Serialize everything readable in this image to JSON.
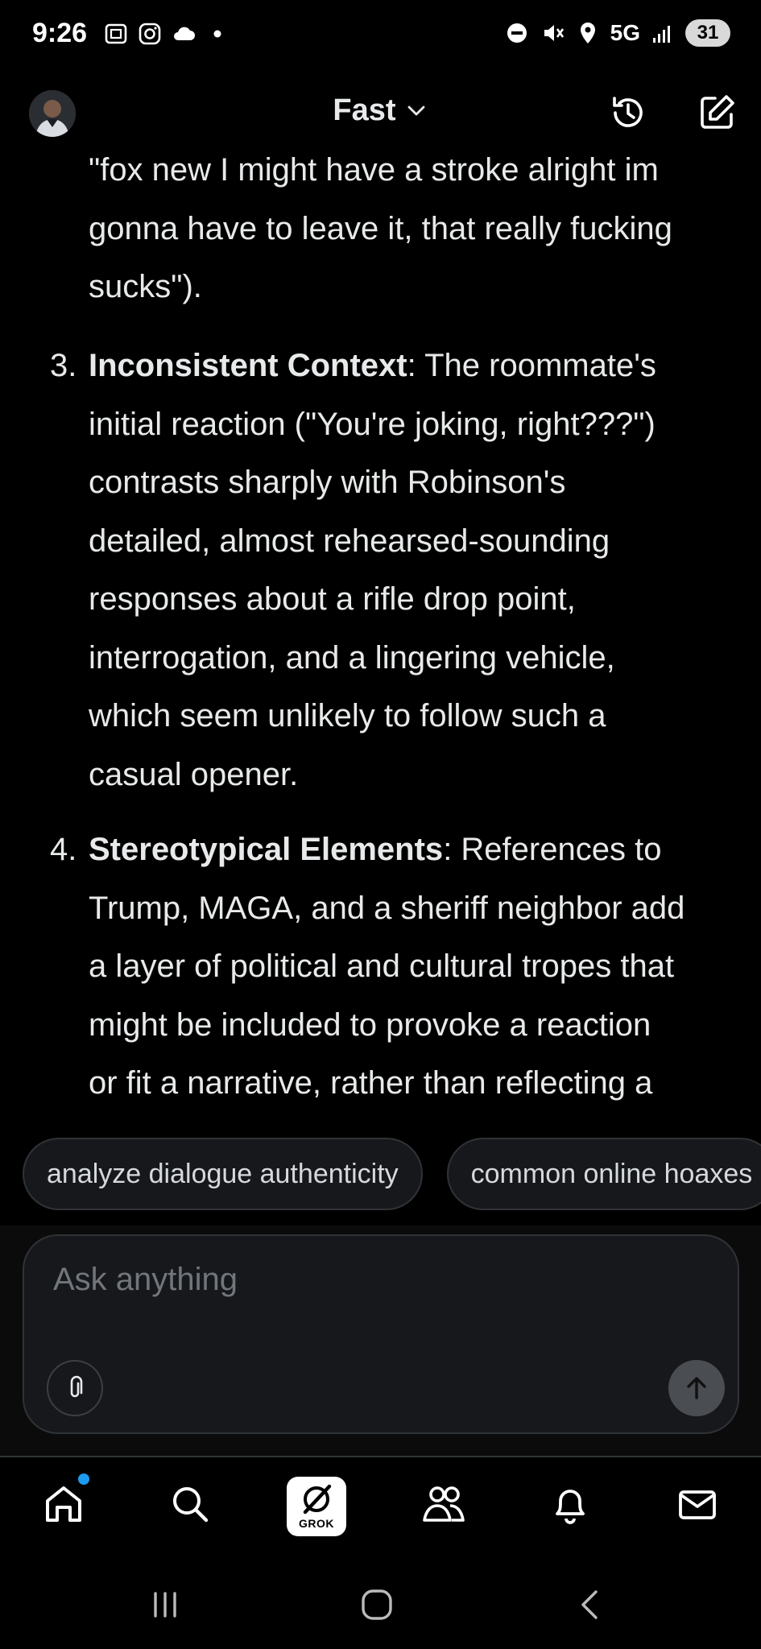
{
  "status_bar": {
    "time": "9:26",
    "network": "5G",
    "battery": "31"
  },
  "header": {
    "model_label": "Fast"
  },
  "message": {
    "lead_lines": [
      "\"fox new I might have a stroke alright im",
      "gonna have to leave it, that really fucking",
      "sucks\")."
    ],
    "items": [
      {
        "number": "3.",
        "title": "Inconsistent Context",
        "lines": [
          ": The roommate's",
          "initial reaction (\"You're joking, right???\")",
          "contrasts sharply with Robinson's",
          "detailed, almost rehearsed-sounding",
          "responses about a rifle drop point,",
          "interrogation, and a lingering vehicle,",
          "which seem unlikely to follow such a",
          "casual opener."
        ]
      },
      {
        "number": "4.",
        "title": "Stereotypical Elements",
        "lines": [
          ": References to",
          "Trump, MAGA, and a sheriff neighbor add",
          "a layer of political and cultural tropes that",
          "might be included to provoke a reaction",
          "or fit a narrative, rather than reflecting a"
        ]
      }
    ]
  },
  "suggestions": [
    "analyze dialogue authenticity",
    "common online hoaxes"
  ],
  "composer": {
    "placeholder": "Ask anything"
  },
  "bottom_nav": {
    "grok_label": "GROK"
  },
  "colors": {
    "background": "#000000",
    "text": "#e7e9ea",
    "accent_dot": "#1d9bf0",
    "chip_border": "#2f3336"
  }
}
